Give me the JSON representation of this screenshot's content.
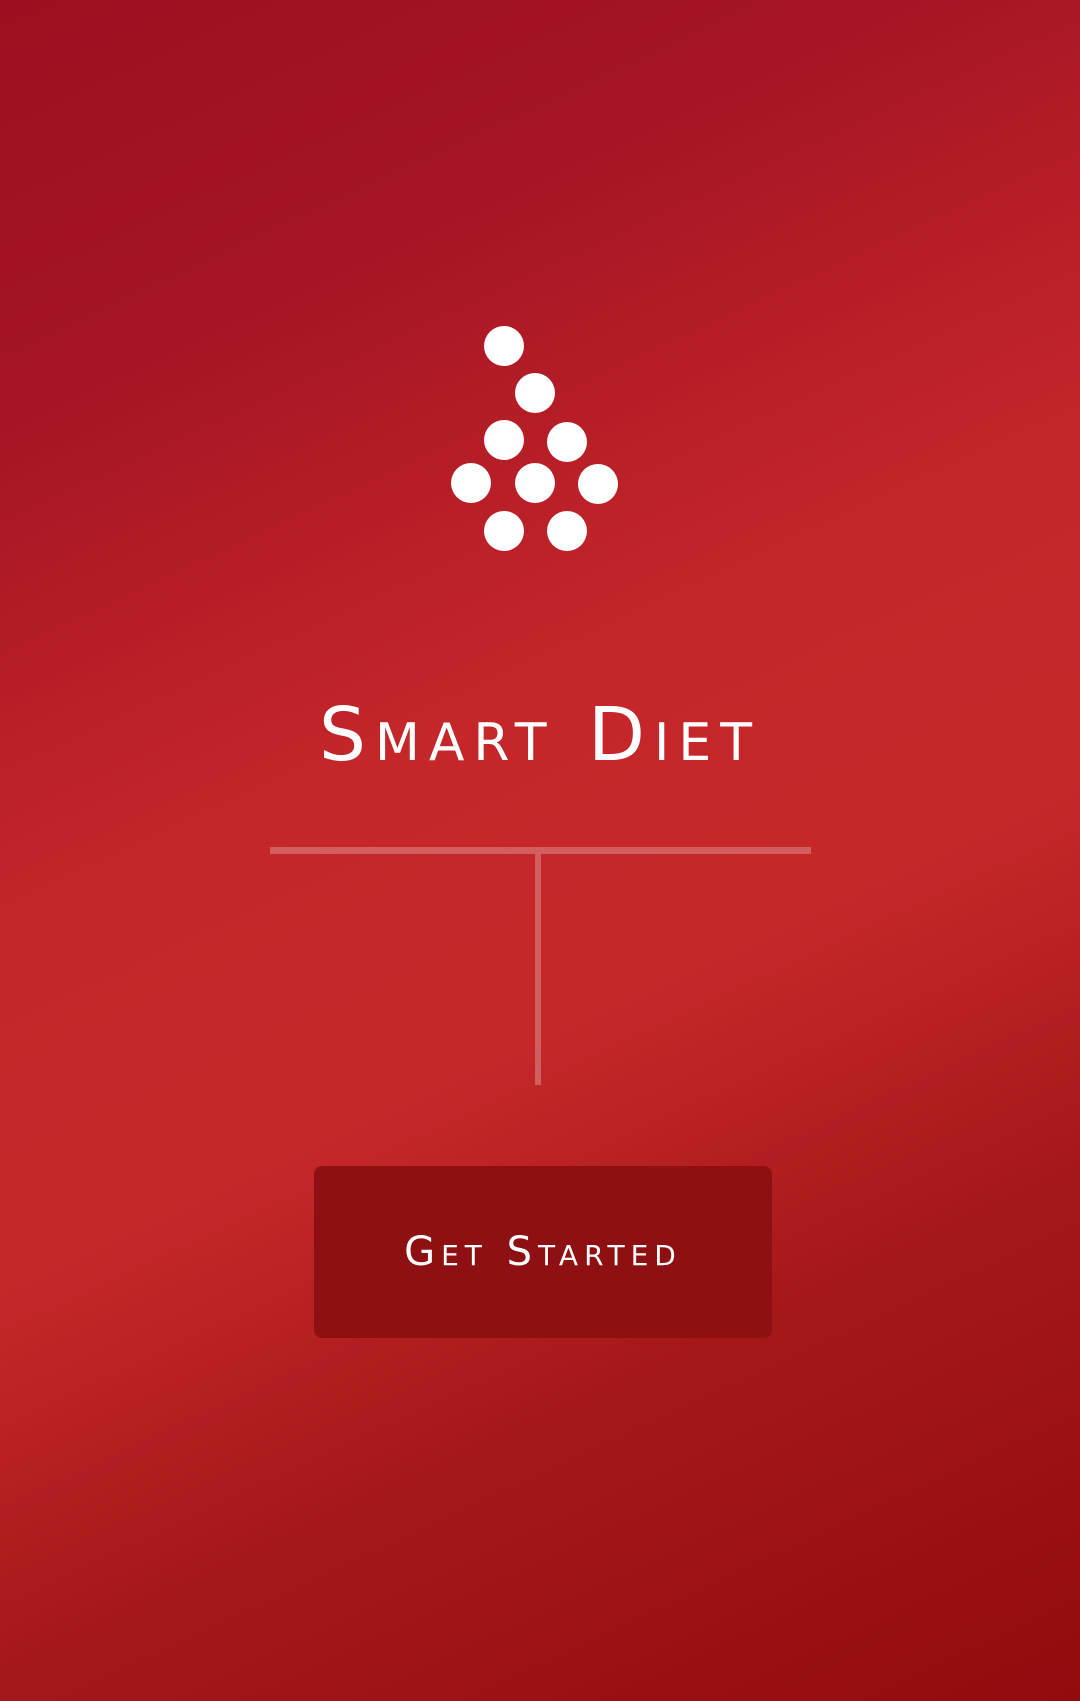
{
  "app": {
    "title": "Smart Diet",
    "logo_icon": "water-drop-dots-icon"
  },
  "actions": {
    "get_started_label": "Get Started"
  },
  "colors": {
    "background_gradient": [
      "#9d0f20",
      "#c6282a",
      "#930b0e"
    ],
    "button_background": "#8f1012",
    "text": "#ffffff",
    "divider": "#dc8c8c"
  }
}
